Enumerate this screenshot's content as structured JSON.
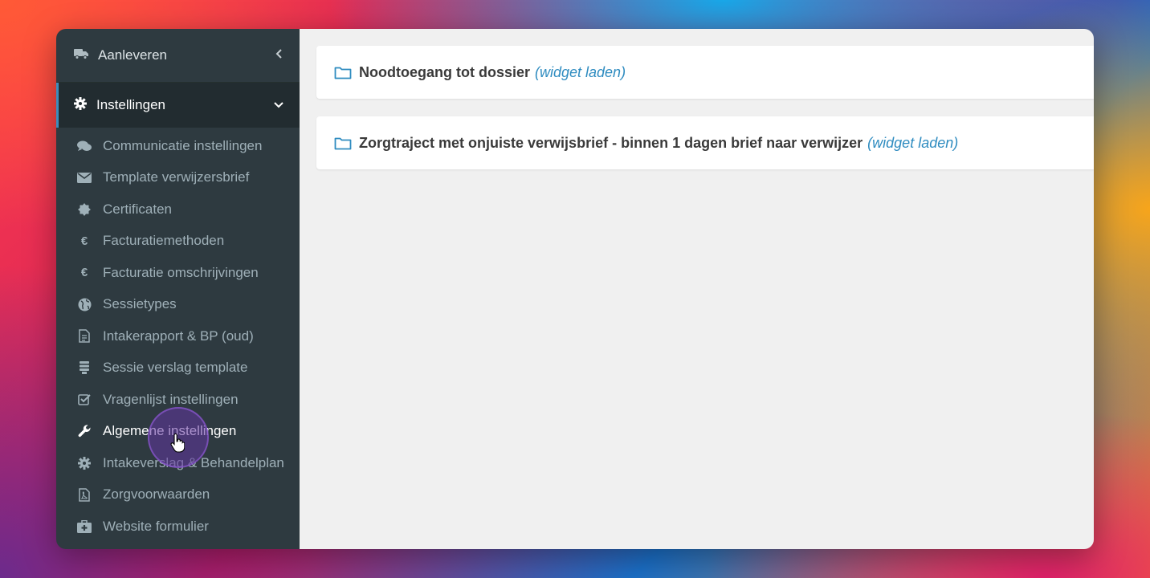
{
  "nav": {
    "aanleveren": {
      "label": "Aanleveren",
      "icon": "truck-icon"
    },
    "instellingen": {
      "label": "Instellingen",
      "icon": "gear-icon"
    }
  },
  "submenu": [
    {
      "label": "Communicatie instellingen",
      "icon": "comments-icon"
    },
    {
      "label": "Template verwijzersbrief",
      "icon": "envelope-icon"
    },
    {
      "label": "Certificaten",
      "icon": "certificate-icon"
    },
    {
      "label": "Facturatiemethoden",
      "icon": "euro-icon"
    },
    {
      "label": "Facturatie omschrijvingen",
      "icon": "euro-icon"
    },
    {
      "label": "Sessietypes",
      "icon": "globe-icon"
    },
    {
      "label": "Intakerapport & BP (oud)",
      "icon": "file-text-icon"
    },
    {
      "label": "Sessie verslag template",
      "icon": "list-icon"
    },
    {
      "label": "Vragenlijst instellingen",
      "icon": "check-square-icon"
    },
    {
      "label": "Algemene instellingen",
      "icon": "wrench-icon"
    },
    {
      "label": "Intakeverslag & Behandelplan",
      "icon": "gear-icon"
    },
    {
      "label": "Zorgvoorwaarden",
      "icon": "file-pdf-icon"
    },
    {
      "label": "Website formulier",
      "icon": "medkit-icon"
    }
  ],
  "widgets": [
    {
      "title": "Noodtoegang tot dossier",
      "link": "(widget laden)"
    },
    {
      "title": "Zorgtraject met onjuiste verwijsbrief - binnen 1 dagen brief naar verwijzer",
      "link": "(widget laden)"
    }
  ],
  "colors": {
    "sidebar_bg": "#2e3a40",
    "active_bg": "#222c30",
    "accent": "#3c8dbc",
    "link": "#2f8cc0",
    "cursor_highlight": "#6234a0"
  }
}
